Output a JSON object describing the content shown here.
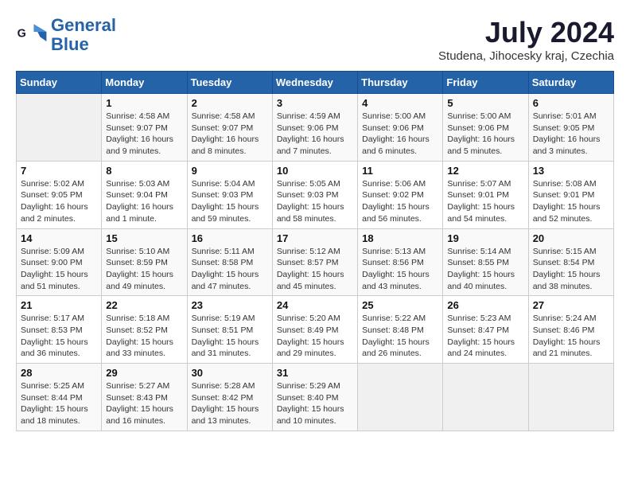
{
  "header": {
    "logo_line1": "General",
    "logo_line2": "Blue",
    "month": "July 2024",
    "location": "Studena, Jihocesky kraj, Czechia"
  },
  "weekdays": [
    "Sunday",
    "Monday",
    "Tuesday",
    "Wednesday",
    "Thursday",
    "Friday",
    "Saturday"
  ],
  "weeks": [
    [
      {
        "num": "",
        "info": ""
      },
      {
        "num": "1",
        "info": "Sunrise: 4:58 AM\nSunset: 9:07 PM\nDaylight: 16 hours\nand 9 minutes."
      },
      {
        "num": "2",
        "info": "Sunrise: 4:58 AM\nSunset: 9:07 PM\nDaylight: 16 hours\nand 8 minutes."
      },
      {
        "num": "3",
        "info": "Sunrise: 4:59 AM\nSunset: 9:06 PM\nDaylight: 16 hours\nand 7 minutes."
      },
      {
        "num": "4",
        "info": "Sunrise: 5:00 AM\nSunset: 9:06 PM\nDaylight: 16 hours\nand 6 minutes."
      },
      {
        "num": "5",
        "info": "Sunrise: 5:00 AM\nSunset: 9:06 PM\nDaylight: 16 hours\nand 5 minutes."
      },
      {
        "num": "6",
        "info": "Sunrise: 5:01 AM\nSunset: 9:05 PM\nDaylight: 16 hours\nand 3 minutes."
      }
    ],
    [
      {
        "num": "7",
        "info": "Sunrise: 5:02 AM\nSunset: 9:05 PM\nDaylight: 16 hours\nand 2 minutes."
      },
      {
        "num": "8",
        "info": "Sunrise: 5:03 AM\nSunset: 9:04 PM\nDaylight: 16 hours\nand 1 minute."
      },
      {
        "num": "9",
        "info": "Sunrise: 5:04 AM\nSunset: 9:03 PM\nDaylight: 15 hours\nand 59 minutes."
      },
      {
        "num": "10",
        "info": "Sunrise: 5:05 AM\nSunset: 9:03 PM\nDaylight: 15 hours\nand 58 minutes."
      },
      {
        "num": "11",
        "info": "Sunrise: 5:06 AM\nSunset: 9:02 PM\nDaylight: 15 hours\nand 56 minutes."
      },
      {
        "num": "12",
        "info": "Sunrise: 5:07 AM\nSunset: 9:01 PM\nDaylight: 15 hours\nand 54 minutes."
      },
      {
        "num": "13",
        "info": "Sunrise: 5:08 AM\nSunset: 9:01 PM\nDaylight: 15 hours\nand 52 minutes."
      }
    ],
    [
      {
        "num": "14",
        "info": "Sunrise: 5:09 AM\nSunset: 9:00 PM\nDaylight: 15 hours\nand 51 minutes."
      },
      {
        "num": "15",
        "info": "Sunrise: 5:10 AM\nSunset: 8:59 PM\nDaylight: 15 hours\nand 49 minutes."
      },
      {
        "num": "16",
        "info": "Sunrise: 5:11 AM\nSunset: 8:58 PM\nDaylight: 15 hours\nand 47 minutes."
      },
      {
        "num": "17",
        "info": "Sunrise: 5:12 AM\nSunset: 8:57 PM\nDaylight: 15 hours\nand 45 minutes."
      },
      {
        "num": "18",
        "info": "Sunrise: 5:13 AM\nSunset: 8:56 PM\nDaylight: 15 hours\nand 43 minutes."
      },
      {
        "num": "19",
        "info": "Sunrise: 5:14 AM\nSunset: 8:55 PM\nDaylight: 15 hours\nand 40 minutes."
      },
      {
        "num": "20",
        "info": "Sunrise: 5:15 AM\nSunset: 8:54 PM\nDaylight: 15 hours\nand 38 minutes."
      }
    ],
    [
      {
        "num": "21",
        "info": "Sunrise: 5:17 AM\nSunset: 8:53 PM\nDaylight: 15 hours\nand 36 minutes."
      },
      {
        "num": "22",
        "info": "Sunrise: 5:18 AM\nSunset: 8:52 PM\nDaylight: 15 hours\nand 33 minutes."
      },
      {
        "num": "23",
        "info": "Sunrise: 5:19 AM\nSunset: 8:51 PM\nDaylight: 15 hours\nand 31 minutes."
      },
      {
        "num": "24",
        "info": "Sunrise: 5:20 AM\nSunset: 8:49 PM\nDaylight: 15 hours\nand 29 minutes."
      },
      {
        "num": "25",
        "info": "Sunrise: 5:22 AM\nSunset: 8:48 PM\nDaylight: 15 hours\nand 26 minutes."
      },
      {
        "num": "26",
        "info": "Sunrise: 5:23 AM\nSunset: 8:47 PM\nDaylight: 15 hours\nand 24 minutes."
      },
      {
        "num": "27",
        "info": "Sunrise: 5:24 AM\nSunset: 8:46 PM\nDaylight: 15 hours\nand 21 minutes."
      }
    ],
    [
      {
        "num": "28",
        "info": "Sunrise: 5:25 AM\nSunset: 8:44 PM\nDaylight: 15 hours\nand 18 minutes."
      },
      {
        "num": "29",
        "info": "Sunrise: 5:27 AM\nSunset: 8:43 PM\nDaylight: 15 hours\nand 16 minutes."
      },
      {
        "num": "30",
        "info": "Sunrise: 5:28 AM\nSunset: 8:42 PM\nDaylight: 15 hours\nand 13 minutes."
      },
      {
        "num": "31",
        "info": "Sunrise: 5:29 AM\nSunset: 8:40 PM\nDaylight: 15 hours\nand 10 minutes."
      },
      {
        "num": "",
        "info": ""
      },
      {
        "num": "",
        "info": ""
      },
      {
        "num": "",
        "info": ""
      }
    ]
  ]
}
